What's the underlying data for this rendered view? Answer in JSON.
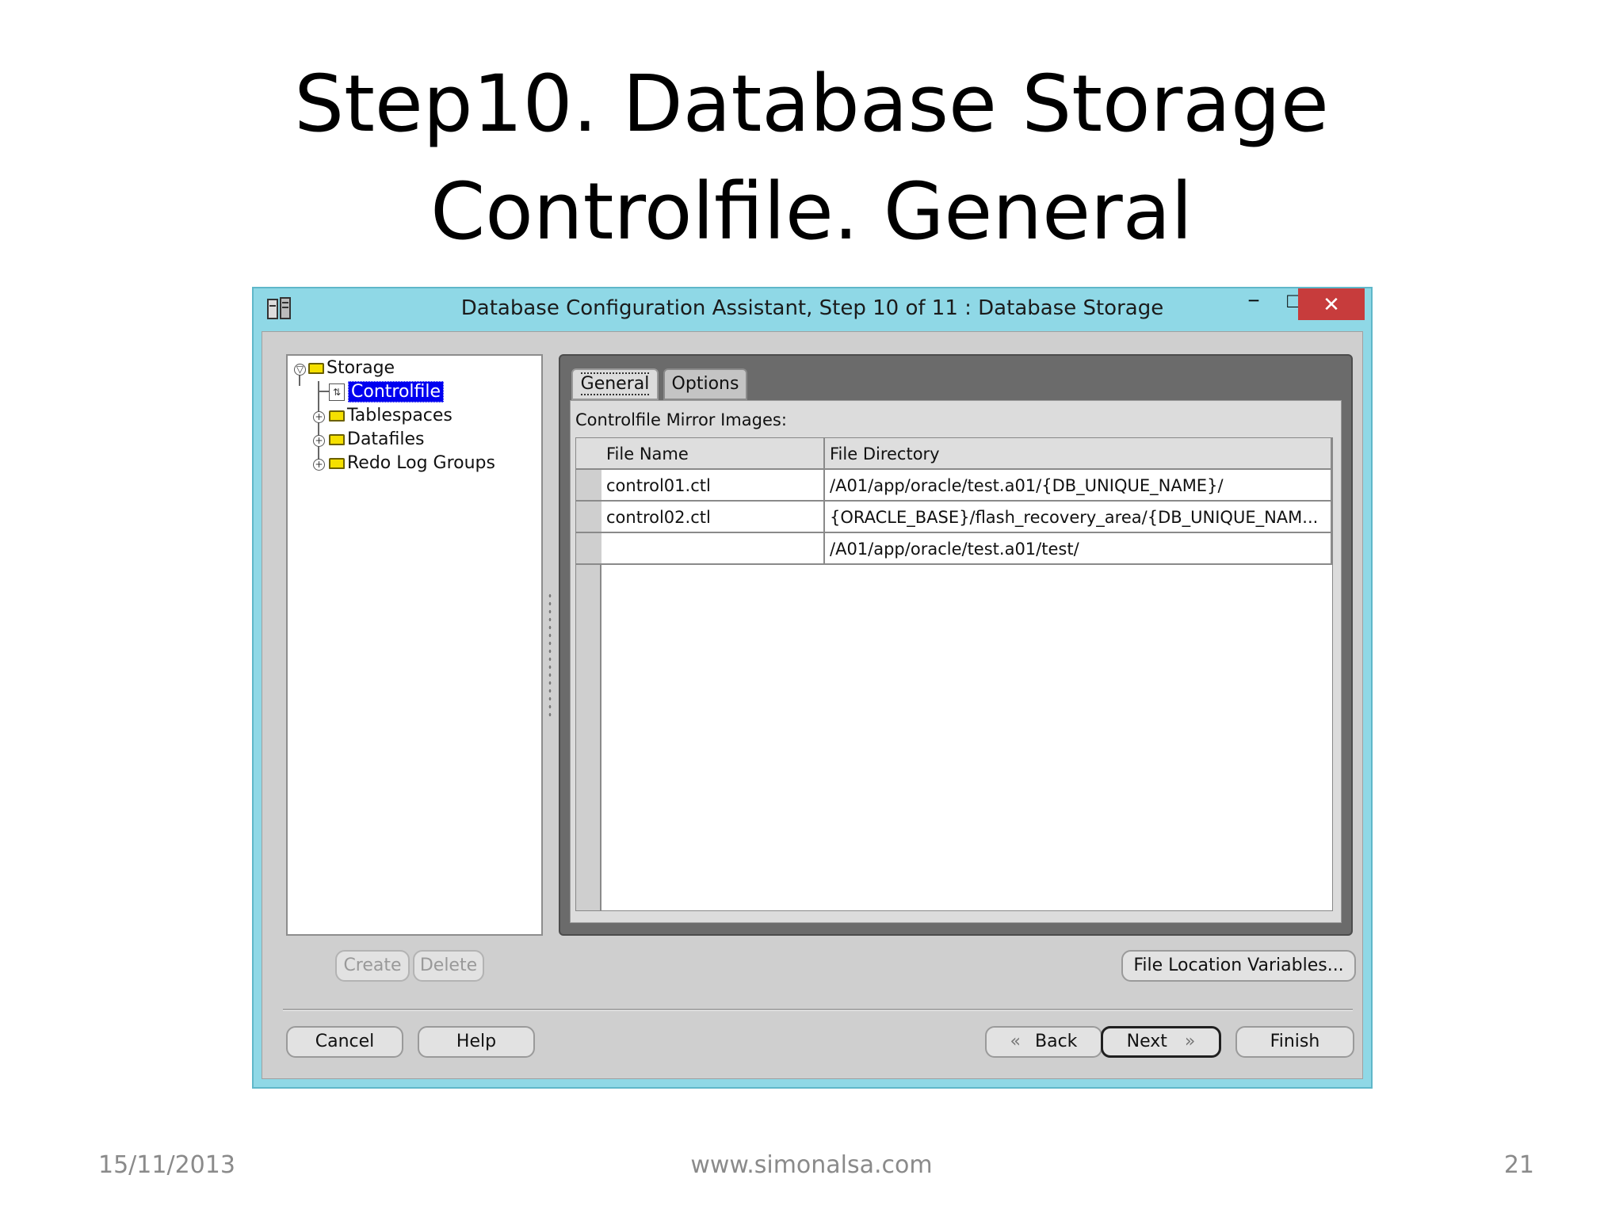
{
  "slide": {
    "title_line1": "Step10. Database Storage",
    "title_line2": "Controlfile. General",
    "footer_date": "15/11/2013",
    "footer_site": "www.simonalsa.com",
    "footer_page": "21"
  },
  "window": {
    "title": "Database Configuration Assistant, Step 10 of 11 : Database Storage",
    "minimize": "−",
    "maximize": "□",
    "close": "✕"
  },
  "tree": {
    "root": "Storage",
    "items": [
      {
        "label": "Controlfile",
        "selected": true
      },
      {
        "label": "Tablespaces"
      },
      {
        "label": "Datafiles"
      },
      {
        "label": "Redo Log Groups"
      }
    ]
  },
  "tree_buttons": {
    "create": "Create",
    "delete": "Delete"
  },
  "tabs": {
    "general": "General",
    "options": "Options"
  },
  "panel": {
    "label": "Controlfile Mirror Images:",
    "columns": [
      "File Name",
      "File Directory"
    ],
    "rows": [
      {
        "file_name": "control01.ctl",
        "file_directory": "/A01/app/oracle/test.a01/{DB_UNIQUE_NAME}/"
      },
      {
        "file_name": "control02.ctl",
        "file_directory": "{ORACLE_BASE}/flash_recovery_area/{DB_UNIQUE_NAM..."
      },
      {
        "file_name": "",
        "file_directory": "/A01/app/oracle/test.a01/test/"
      }
    ],
    "file_location_button": "File Location Variables..."
  },
  "nav": {
    "cancel": "Cancel",
    "help": "Help",
    "back": "Back",
    "next": "Next",
    "finish": "Finish"
  },
  "colors": {
    "window_frame": "#8fd8e6",
    "close_button": "#c73c3c",
    "selection": "#0000f0"
  },
  "icons": {
    "app": "dbca-app-icon",
    "back": "double-chevron-left-icon",
    "next": "double-chevron-right-icon"
  }
}
